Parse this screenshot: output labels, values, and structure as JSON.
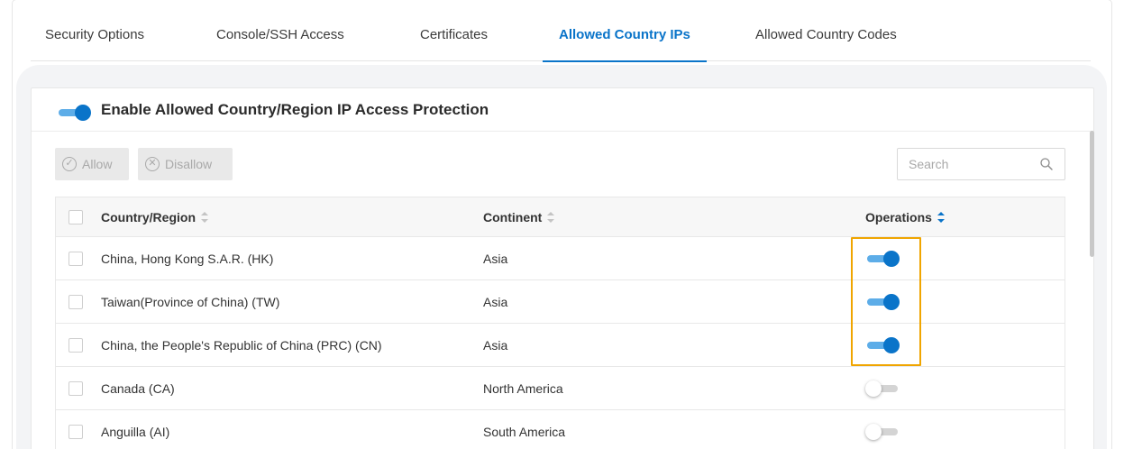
{
  "tabs": [
    {
      "label": "Security Options",
      "active": false
    },
    {
      "label": "Console/SSH Access",
      "active": false
    },
    {
      "label": "Certificates",
      "active": false
    },
    {
      "label": "Allowed Country IPs",
      "active": true
    },
    {
      "label": "Allowed Country Codes",
      "active": false
    }
  ],
  "protection": {
    "title": "Enable Allowed Country/Region IP Access Protection",
    "enabled": true
  },
  "toolbar": {
    "allow_label": "Allow",
    "disallow_label": "Disallow",
    "allow_icon": "check-circle-icon",
    "disallow_icon": "x-circle-icon"
  },
  "search": {
    "placeholder": "Search",
    "value": "",
    "icon": "search-icon"
  },
  "table": {
    "columns": [
      "Country/Region",
      "Continent",
      "Operations"
    ],
    "rows": [
      {
        "country": "China, Hong Kong S.A.R. (HK)",
        "continent": "Asia",
        "allowed": true
      },
      {
        "country": "Taiwan(Province of China) (TW)",
        "continent": "Asia",
        "allowed": true
      },
      {
        "country": "China, the People's Republic of China (PRC) (CN)",
        "continent": "Asia",
        "allowed": true
      },
      {
        "country": "Canada (CA)",
        "continent": "North America",
        "allowed": false
      },
      {
        "country": "Anguilla (AI)",
        "continent": "South America",
        "allowed": false
      }
    ]
  },
  "colors": {
    "accent": "#0a74c9",
    "highlight": "#f0a500"
  }
}
